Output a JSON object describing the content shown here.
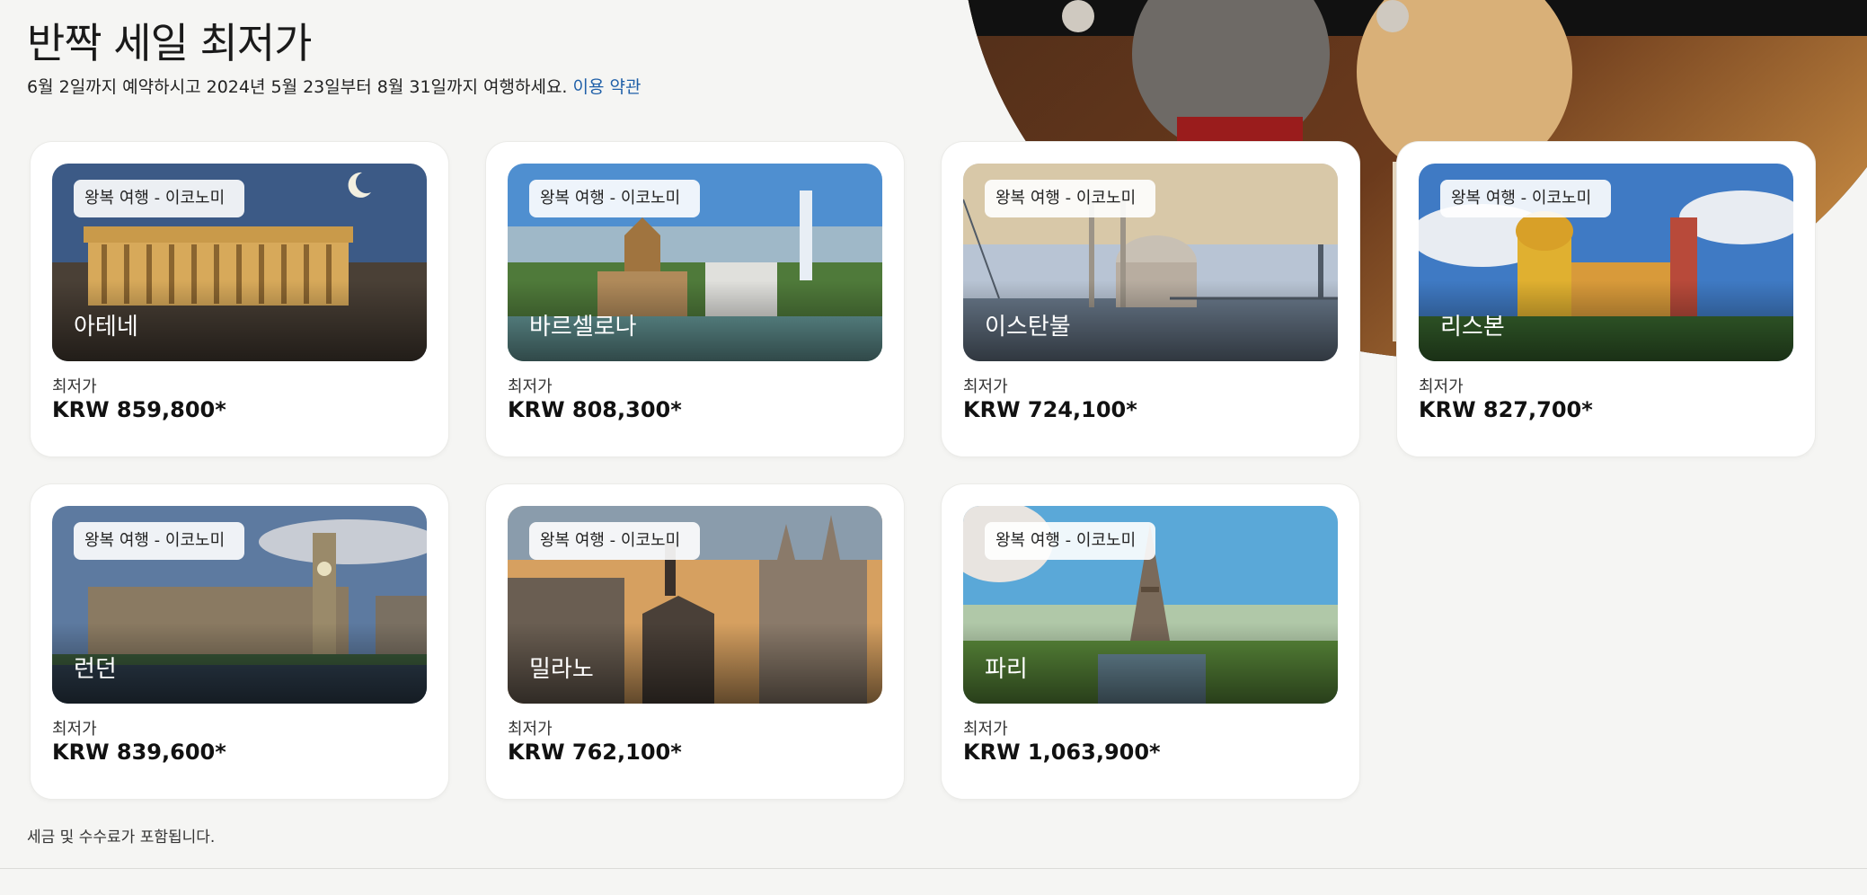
{
  "header": {
    "title": "반짝 세일 최저가",
    "subtitle_text": "6월 2일까지 예약하시고 2024년 5월 23일부터 8월 31일까지 여행하세요.",
    "terms_link": "이용 약관"
  },
  "cards": [
    {
      "tag": "왕복 여행 - 이코노미",
      "city": "아테네",
      "price_label": "최저가",
      "price": "KRW 859,800*"
    },
    {
      "tag": "왕복 여행 - 이코노미",
      "city": "바르셀로나",
      "price_label": "최저가",
      "price": "KRW 808,300*"
    },
    {
      "tag": "왕복 여행 - 이코노미",
      "city": "이스탄불",
      "price_label": "최저가",
      "price": "KRW 724,100*"
    },
    {
      "tag": "왕복 여행 - 이코노미",
      "city": "리스본",
      "price_label": "최저가",
      "price": "KRW 827,700*"
    },
    {
      "tag": "왕복 여행 - 이코노미",
      "city": "런던",
      "price_label": "최저가",
      "price": "KRW 839,600*"
    },
    {
      "tag": "왕복 여행 - 이코노미",
      "city": "밀라노",
      "price_label": "최저가",
      "price": "KRW 762,100*"
    },
    {
      "tag": "왕복 여행 - 이코노미",
      "city": "파리",
      "price_label": "최저가",
      "price": "KRW 1,063,900*"
    }
  ],
  "footnote": "세금 및 수수료가 포함됩니다.",
  "colors": {
    "link": "#1f5fa8",
    "background": "#f5f5f3",
    "card": "#ffffff"
  }
}
